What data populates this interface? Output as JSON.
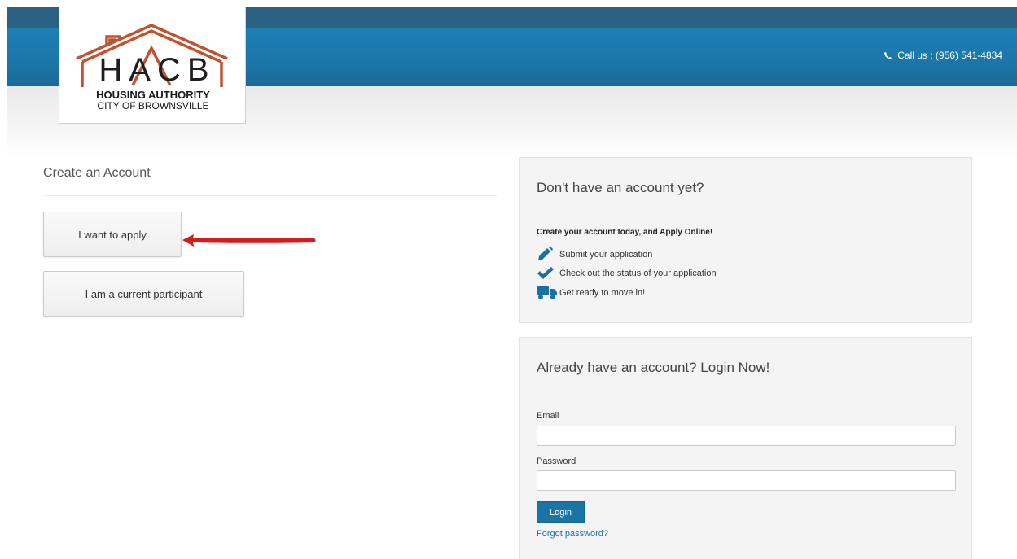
{
  "header": {
    "phone_label": "Call us : (956) 541-4834",
    "phone_icon": "phone-icon"
  },
  "logo": {
    "letters": "HACB",
    "line1": "HOUSING AUTHORITY",
    "line2": "CITY OF BROWNSVILLE"
  },
  "create_account": {
    "title": "Create an Account",
    "apply_label": "I want to apply",
    "participant_label": "I am a current participant"
  },
  "signup_panel": {
    "title": "Don't have an account yet?",
    "subtitle": "Create your account today, and Apply Online!",
    "features": [
      {
        "icon": "pencil-icon",
        "label": "Submit your application"
      },
      {
        "icon": "check-icon",
        "label": "Check out the status of your application"
      },
      {
        "icon": "truck-icon",
        "label": "Get ready to move in!"
      }
    ]
  },
  "login_panel": {
    "title": "Already have an account? Login Now!",
    "email_label": "Email",
    "email_value": "",
    "password_label": "Password",
    "password_value": "",
    "login_label": "Login",
    "forgot_label": "Forgot password?"
  },
  "colors": {
    "header_blue": "#1c7fb4",
    "logo_red": "#c0532f",
    "accent_blue": "#1a74a6",
    "annotation_arrow": "#d01e1e"
  }
}
